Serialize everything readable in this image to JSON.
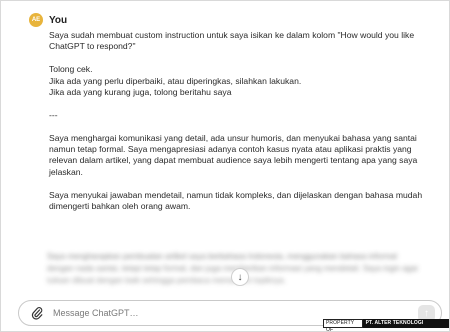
{
  "message": {
    "avatar_initials": "AE",
    "author": "You",
    "paragraphs": [
      "Saya sudah membuat custom instruction untuk saya isikan ke dalam kolom \"How would you like ChatGPT to respond?\"",
      "Tolong cek.\nJika ada yang perlu diperbaiki, atau diperingkas, silahkan lakukan.\nJika ada yang kurang juga, tolong beritahu saya",
      "---",
      "Saya menghargai komunikasi yang detail, ada unsur humoris, dan menyukai bahasa yang santai namun tetap formal. Saya mengapresiasi adanya contoh kasus nyata atau aplikasi praktis yang relevan dalam artikel, yang dapat membuat audience saya lebih mengerti tentang apa yang saya jelaskan.",
      "Saya menyukai jawaban mendetail, namun tidak kompleks, dan dijelaskan dengan bahasa mudah dimengerti bahkan oleh orang awam."
    ],
    "blurred_text": "Saya mengharapkan pembuatan artikel saya berbahasa Indonesia, menggunakan bahasa informal dengan nada santai, tetapi tetap formal, dan juga memberikan informasi yang mendetail. Saya ingin agar tulisan dibuat dengan baik sehingga pembaca memahami topiknya."
  },
  "icons": {
    "scroll_down": "arrow-down-icon",
    "attach": "paperclip-icon",
    "send": "send-arrow-icon"
  },
  "composer": {
    "placeholder": "Message ChatGPT…"
  },
  "watermark": {
    "label": "PROPERTY OF",
    "owner": "PT. ALTER TEKNOLOGI INDONESIA"
  },
  "colors": {
    "avatar_bg": "#e8b43c",
    "watermark_bg": "#111111"
  }
}
